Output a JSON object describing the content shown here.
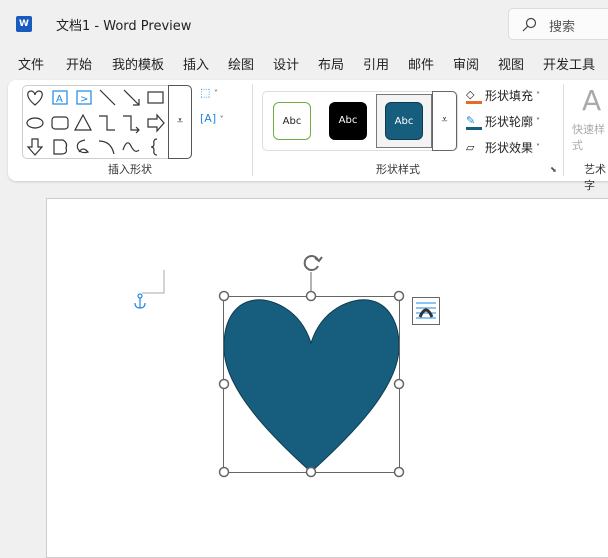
{
  "titlebar": {
    "app_icon": "word-icon",
    "title": "文档1  -  Word Preview",
    "search_placeholder": "搜索"
  },
  "tabs": [
    "文件",
    "开始",
    "我的模板",
    "插入",
    "绘图",
    "设计",
    "布局",
    "引用",
    "邮件",
    "审阅",
    "视图",
    "开发工具"
  ],
  "ribbon": {
    "insert_shapes": {
      "label": "插入形状",
      "shapes": [
        "heart",
        "text-box",
        "vertical-text-box",
        "line",
        "arrow-line",
        "rectangle",
        "oval",
        "rounded-rectangle",
        "triangle",
        "elbow-connector",
        "elbow-arrow-connector",
        "right-arrow",
        "down-arrow",
        "snip-shape",
        "freeform-scribble",
        "arc",
        "curve",
        "left-brace"
      ]
    },
    "shape_styles": {
      "label": "形状样式",
      "swatches": [
        {
          "text": "Abc",
          "bg": "#ffffff",
          "border": "#70ad47",
          "color": "#222222"
        },
        {
          "text": "Abc",
          "bg": "#000000",
          "border": "#000000",
          "color": "#ffffff"
        },
        {
          "text": "Abc",
          "bg": "#175e7e",
          "border": "#0e3a4f",
          "color": "#ffffff"
        }
      ],
      "fill": "形状填充",
      "outline": "形状轮廓",
      "effects": "形状效果"
    },
    "wordart": {
      "quick_styles": "快速样式",
      "label": "艺术字"
    }
  },
  "shape": {
    "type": "heart",
    "fill": "#175e7e"
  }
}
